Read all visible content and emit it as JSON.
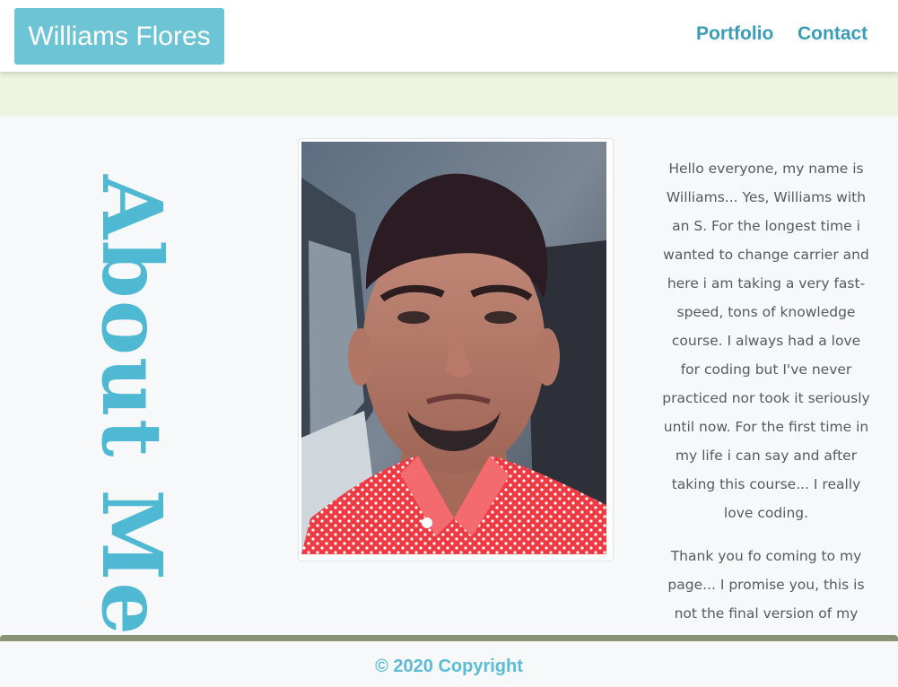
{
  "navbar": {
    "brand": "Williams Flores",
    "links": [
      {
        "label": "Portfolio"
      },
      {
        "label": "Contact"
      }
    ]
  },
  "about": {
    "title": "About Me",
    "photo_icon": "profile-photo",
    "paragraphs": [
      "Hello everyone, my name is Williams... Yes, Williams with an S. For the longest time i wanted to change carrier and here i am taking a very fast-speed, tons of knowledge course. I always had a love for coding but I've never practiced nor took it seriously until now. For the first time in my life i can say and after taking this course... I really love coding.",
      "Thank you fo coming to my page... I promise you, this is not the final version of my"
    ]
  },
  "footer": {
    "copyright": "© 2020 Copyright"
  },
  "colors": {
    "brand_bg": "#6cc4d4",
    "nav_link": "#3a9db8",
    "title": "#4fb8d3",
    "band": "#eef4de",
    "footer_bar": "#8a9274"
  }
}
